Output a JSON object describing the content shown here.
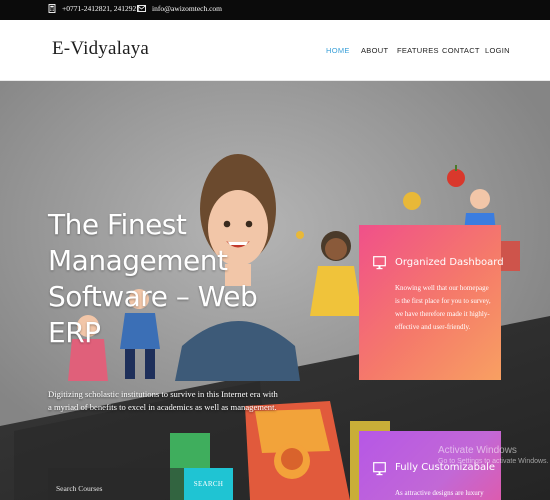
{
  "topbar": {
    "phone": "+0771-2412821, 2412921",
    "email": "info@awizomtech.com",
    "phone_icon": "phone-icon",
    "email_icon": "envelope-icon"
  },
  "header": {
    "logo": "E-Vidyalaya",
    "nav": [
      {
        "label": "HOME",
        "active": true
      },
      {
        "label": "ABOUT",
        "active": false
      },
      {
        "label": "FEATURES",
        "active": false
      },
      {
        "label": "CONTACT",
        "active": false
      },
      {
        "label": "LOGIN",
        "active": false
      }
    ],
    "active_color": "#3aa0d8"
  },
  "hero": {
    "title": "The Finest Management Software – Web ERP",
    "subtitle": "Digitizing scholastic institutions to survive in this Internet era with a myriad of benefits to excel in academics as well as management.",
    "search": {
      "placeholder": "Search Courses",
      "button": "SEARCH",
      "button_color": "#1fc4d3"
    }
  },
  "cards": [
    {
      "icon": "monitor-icon",
      "title": "Organized Dashboard",
      "text": "Knowing well that our homepage is the first place for you to survey, we have therefore made it highly-effective and user-friendly."
    },
    {
      "icon": "monitor-icon",
      "title": "Fully Customizabale",
      "text": "As attractive designs are luxury"
    }
  ],
  "watermark": {
    "title": "Activate Windows",
    "subtitle": "Go to Settings to activate Windows."
  }
}
